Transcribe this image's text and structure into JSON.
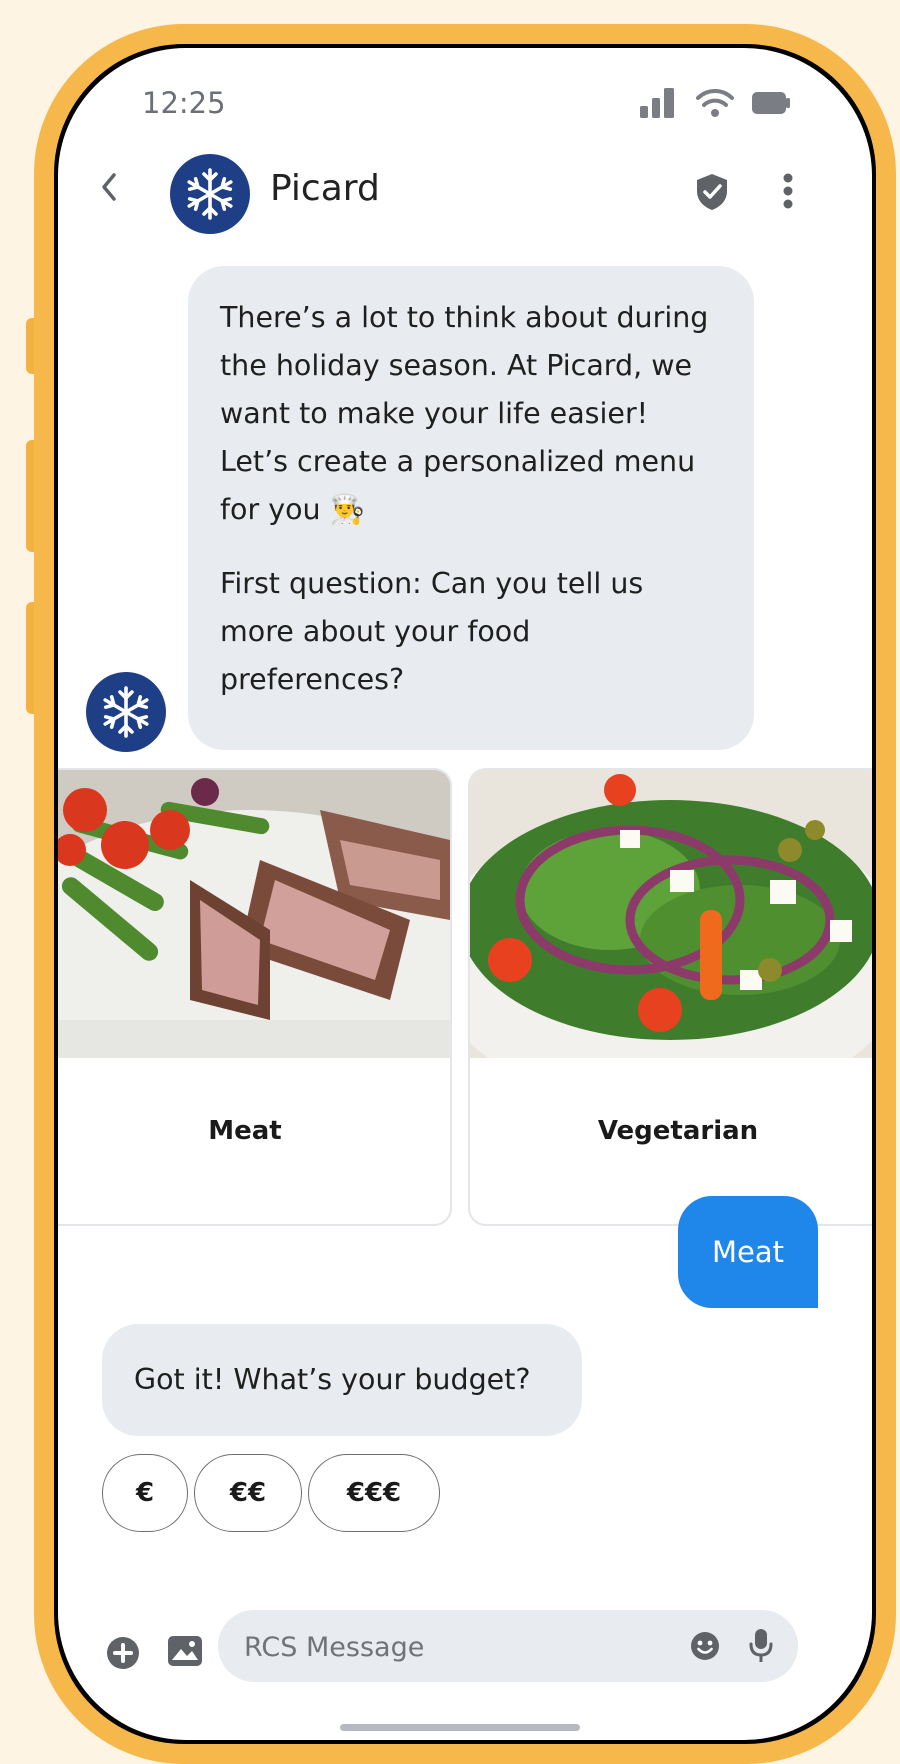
{
  "status_bar": {
    "time": "12:25"
  },
  "header": {
    "contact_name": "Picard"
  },
  "messages": {
    "intro_p1": "There’s a lot to think about during the holiday season. At Picard, we want to make your life easier! Let’s create a personalized menu for you 👨‍🍳",
    "intro_p2": "First question: Can you tell us more about your food preferences?",
    "user_reply": "Meat",
    "budget_question": "Got it! What’s your budget?"
  },
  "cards": [
    {
      "label": "Meat",
      "image": "grilled-meat-plate-image"
    },
    {
      "label": "Vegetarian",
      "image": "salad-bowl-image"
    }
  ],
  "suggestions": [
    "€",
    "€€",
    "€€€"
  ],
  "composer": {
    "placeholder": "RCS Message"
  },
  "colors": {
    "phone_frame": "#f6b84a",
    "brand_avatar": "#1e3f86",
    "user_bubble": "#1f86ea",
    "bot_bubble": "#e8ebef",
    "page_background": "#fdf4e3"
  }
}
